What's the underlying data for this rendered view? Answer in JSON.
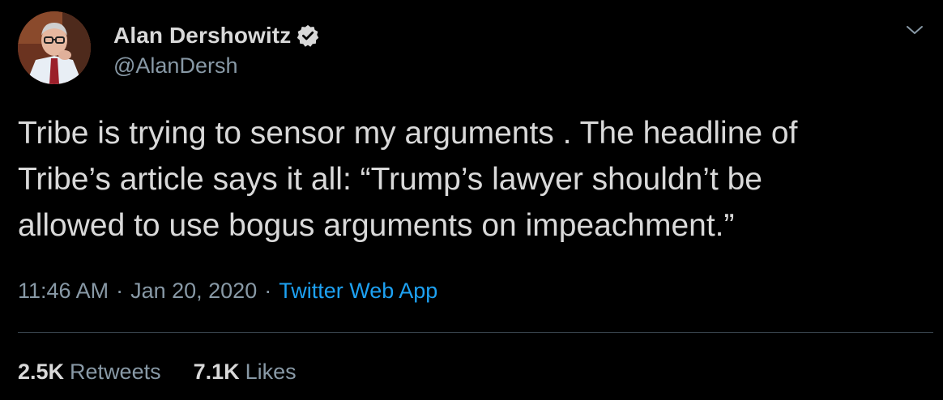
{
  "author": {
    "display_name": "Alan Dershowitz",
    "handle": "@AlanDersh",
    "verified": true,
    "avatar_icon": "profile-photo"
  },
  "tweet": {
    "text": "Tribe is trying to sensor my arguments . The headline of\nTribe’s article says it all: “Trump’s lawyer shouldn’t be\nallowed to use bogus arguments on impeachment.”",
    "time": "11:46 AM",
    "date": "Jan 20, 2020",
    "separator": "·",
    "source": "Twitter Web App"
  },
  "stats": {
    "retweets_count": "2.5K",
    "retweets_label": "Retweets",
    "likes_count": "7.1K",
    "likes_label": "Likes"
  },
  "colors": {
    "background": "#000000",
    "primary_text": "#d9d9d9",
    "secondary_text": "#8899a6",
    "accent": "#1da1f2",
    "divider": "#38444d"
  },
  "icons": {
    "verified": "verified-badge-icon",
    "menu": "chevron-down-icon"
  }
}
